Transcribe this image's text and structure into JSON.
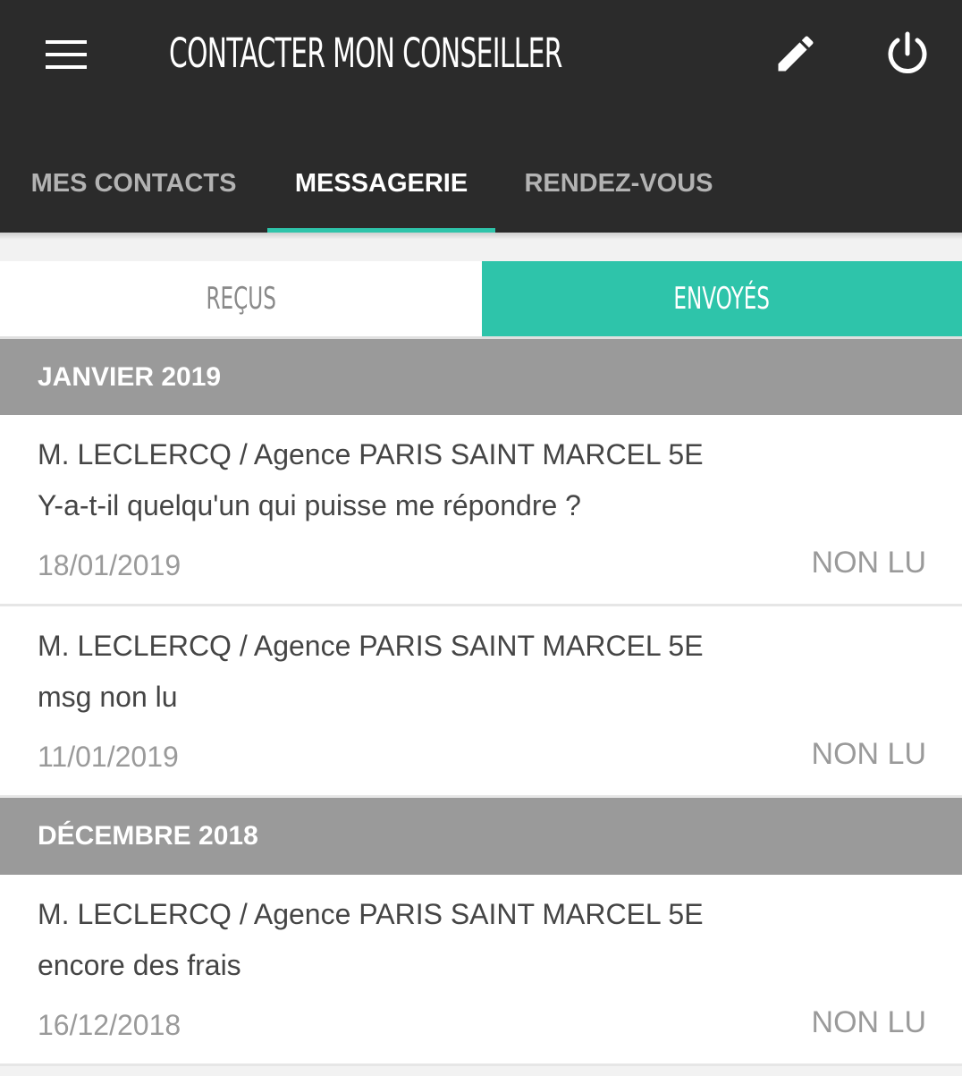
{
  "header": {
    "title": "CONTACTER MON CONSEILLER",
    "menu_icon": "hamburger-menu-icon",
    "edit_icon": "pencil-icon",
    "power_icon": "power-icon",
    "background_color": "#2b2b2b",
    "accent_color": "#2ec4aa"
  },
  "tabs": [
    {
      "label": "MES CONTACTS",
      "active": false
    },
    {
      "label": "MESSAGERIE",
      "active": true
    },
    {
      "label": "RENDEZ-VOUS",
      "active": false
    }
  ],
  "segments": {
    "received": {
      "label": "REÇUS",
      "active": false
    },
    "sent": {
      "label": "ENVOYÉS",
      "active": true
    }
  },
  "sections": [
    {
      "title": "JANVIER 2019",
      "messages": [
        {
          "sender": "M. LECLERCQ / Agence PARIS SAINT MARCEL 5E",
          "subject": "Y-a-t-il quelqu'un qui puisse me répondre ?",
          "date": "18/01/2019",
          "status": "NON LU"
        },
        {
          "sender": "M. LECLERCQ / Agence PARIS SAINT MARCEL 5E",
          "subject": "msg non lu",
          "date": "11/01/2019",
          "status": "NON LU"
        }
      ]
    },
    {
      "title": "DÉCEMBRE 2018",
      "messages": [
        {
          "sender": "M. LECLERCQ / Agence PARIS SAINT MARCEL 5E",
          "subject": "encore des frais",
          "date": "16/12/2018",
          "status": "NON LU"
        }
      ]
    }
  ]
}
